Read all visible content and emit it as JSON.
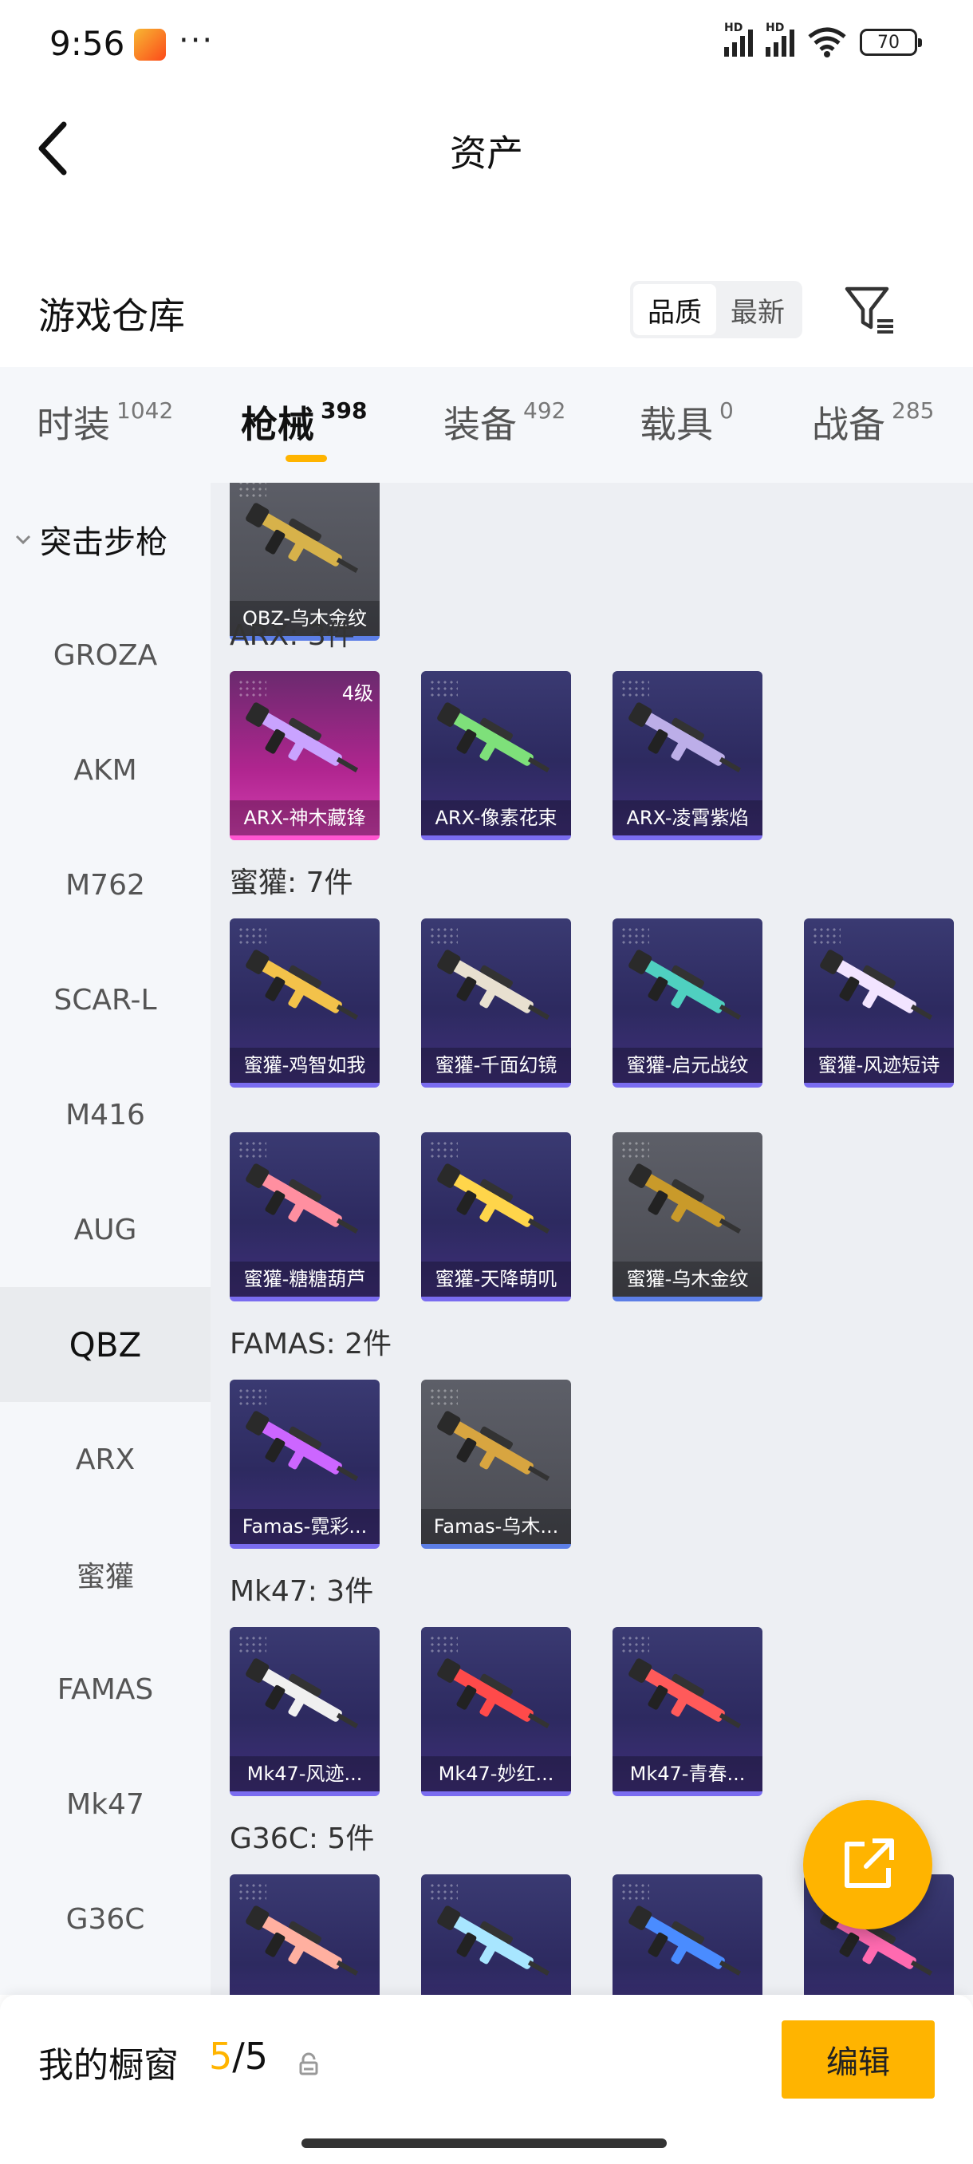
{
  "status_bar": {
    "time": "9:56",
    "more": "···",
    "battery": "70"
  },
  "header": {
    "title": "资产"
  },
  "section": {
    "title": "游戏仓库",
    "sort_options": [
      "品质",
      "最新"
    ],
    "sort_active": "品质"
  },
  "category_tabs": [
    {
      "label": "时装",
      "count": "1042"
    },
    {
      "label": "枪械",
      "count": "398"
    },
    {
      "label": "装备",
      "count": "492"
    },
    {
      "label": "载具",
      "count": "0"
    },
    {
      "label": "战备",
      "count": "285"
    }
  ],
  "sidebar": {
    "group": "突击步枪",
    "items": [
      "GROZA",
      "AKM",
      "M762",
      "SCAR-L",
      "M416",
      "AUG",
      "QBZ",
      "ARX",
      "蜜獾",
      "FAMAS",
      "Mk47",
      "G36C"
    ],
    "selected": "QBZ"
  },
  "groups": [
    {
      "label": "",
      "cards": [
        {
          "name": "QBZ-乌木金纹",
          "style": "gray"
        }
      ]
    },
    {
      "label": "ARX: 3件",
      "cards": [
        {
          "name": "ARX-神木藏锋",
          "style": "pink",
          "badge": "4级"
        },
        {
          "name": "ARX-像素花束",
          "style": "purple"
        },
        {
          "name": "ARX-凌霄紫焰",
          "style": "purple"
        }
      ]
    },
    {
      "label": "蜜獾: 7件",
      "cards": [
        {
          "name": "蜜獾-鸡智如我",
          "style": "purple"
        },
        {
          "name": "蜜獾-千面幻镜",
          "style": "purple"
        },
        {
          "name": "蜜獾-启元战纹",
          "style": "purple"
        },
        {
          "name": "蜜獾-风迹短诗",
          "style": "purple"
        },
        {
          "name": "蜜獾-糖糖葫芦",
          "style": "purple"
        },
        {
          "name": "蜜獾-天降萌叽",
          "style": "purple"
        },
        {
          "name": "蜜獾-乌木金纹",
          "style": "gray"
        }
      ]
    },
    {
      "label": "FAMAS: 2件",
      "cards": [
        {
          "name": "Famas-霓彩...",
          "style": "purple"
        },
        {
          "name": "Famas-乌木...",
          "style": "gray"
        }
      ]
    },
    {
      "label": "Mk47: 3件",
      "cards": [
        {
          "name": "Mk47-风迹...",
          "style": "purple"
        },
        {
          "name": "Mk47-妙红...",
          "style": "purple"
        },
        {
          "name": "Mk47-青春...",
          "style": "purple"
        }
      ]
    },
    {
      "label": "G36C: 5件",
      "cards": [
        {
          "name": "",
          "style": "purple"
        },
        {
          "name": "",
          "style": "purple"
        },
        {
          "name": "",
          "style": "purple"
        },
        {
          "name": "",
          "style": "purple"
        }
      ]
    }
  ],
  "bottom_bar": {
    "label": "我的橱窗",
    "current": "5",
    "separator": "/",
    "total": "5",
    "edit_label": "编辑"
  },
  "colors": {
    "accent": "#ffb400"
  },
  "icons": [
    "back-arrow-icon",
    "filter-icon",
    "chevron-down-icon",
    "share-external-icon",
    "lock-icon"
  ]
}
